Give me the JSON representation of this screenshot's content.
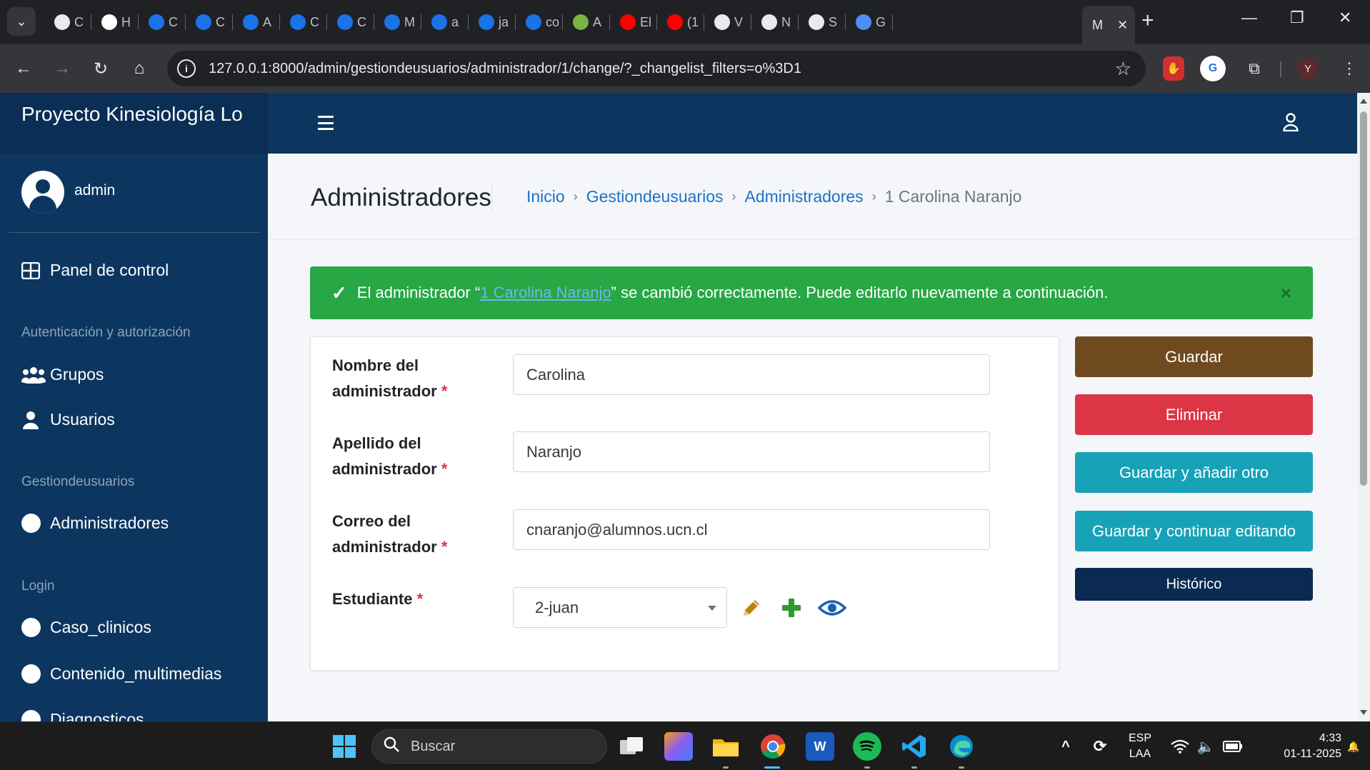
{
  "browser": {
    "tabs": [
      {
        "label": "C",
        "icon": "shield-icon",
        "color": "#e8eaed"
      },
      {
        "label": "H",
        "icon": "github-icon",
        "color": "#ffffff"
      },
      {
        "label": "C",
        "icon": "gear-badge-icon",
        "color": "#1a73e8"
      },
      {
        "label": "C",
        "icon": "gear-badge-icon",
        "color": "#1a73e8"
      },
      {
        "label": "A",
        "icon": "gear-badge-icon",
        "color": "#1a73e8"
      },
      {
        "label": "C",
        "icon": "gear-badge-icon",
        "color": "#1a73e8"
      },
      {
        "label": "C",
        "icon": "gear-badge-icon",
        "color": "#1a73e8"
      },
      {
        "label": "M",
        "icon": "gear-badge-icon",
        "color": "#1a73e8"
      },
      {
        "label": "a",
        "icon": "gear-badge-icon",
        "color": "#1a73e8"
      },
      {
        "label": "ja",
        "icon": "gear-badge-icon",
        "color": "#1a73e8"
      },
      {
        "label": "co",
        "icon": "gear-badge-icon",
        "color": "#1a73e8"
      },
      {
        "label": "A",
        "icon": "id-icon",
        "color": "#7cb342"
      },
      {
        "label": "El",
        "icon": "youtube-icon",
        "color": "#ff0000"
      },
      {
        "label": "(1",
        "icon": "youtube-icon",
        "color": "#ff0000"
      },
      {
        "label": "V",
        "icon": "openai-icon",
        "color": "#e8eaed"
      },
      {
        "label": "N",
        "icon": "openai-icon",
        "color": "#e8eaed"
      },
      {
        "label": "S",
        "icon": "openai-icon",
        "color": "#e8eaed"
      },
      {
        "label": "G",
        "icon": "gemini-icon",
        "color": "#4f8ef7"
      }
    ],
    "active_tab": {
      "label": "M",
      "close": "✕"
    },
    "url": "127.0.0.1:8000/admin/gestiondeusuarios/administrador/1/change/?_changelist_filters=o%3D1",
    "profile_initial": "Y"
  },
  "sidebar": {
    "brand": "Proyecto Kinesiología Lo",
    "user": "admin",
    "items": [
      {
        "label": "Panel de control",
        "icon": "dashboard-icon"
      },
      {
        "label": "Grupos",
        "icon": "users-icon"
      },
      {
        "label": "Usuarios",
        "icon": "user-icon"
      },
      {
        "label": "Administradores",
        "icon": "circle-icon"
      },
      {
        "label": "Caso_clinicos",
        "icon": "circle-icon"
      },
      {
        "label": "Contenido_multimedias",
        "icon": "circle-icon"
      },
      {
        "label": "Diagnosticos",
        "icon": "circle-icon"
      }
    ],
    "headers": [
      "Autenticación y autorización",
      "Gestiondeusuarios",
      "Login"
    ]
  },
  "header": {
    "title": "Administradores",
    "breadcrumb": [
      "Inicio",
      "Gestiondeusuarios",
      "Administradores"
    ],
    "breadcrumb_current": "1 Carolina Naranjo",
    "breadcrumb_sep": "›"
  },
  "alert": {
    "prefix": "El administrador “",
    "link": "1 Carolina Naranjo",
    "suffix": "” se cambió correctamente. Puede editarlo nuevamente a continuación.",
    "close": "×",
    "color": "#28a745"
  },
  "form": {
    "fields": [
      {
        "label_line1": "Nombre del",
        "label_line2": "administrador",
        "value": "Carolina"
      },
      {
        "label_line1": "Apellido del",
        "label_line2": "administrador",
        "value": "Naranjo"
      },
      {
        "label_line1": "Correo del",
        "label_line2": "administrador",
        "value": "cnaranjo@alumnos.ucn.cl"
      }
    ],
    "estudiante_label": "Estudiante",
    "estudiante_value": "2-juan",
    "required_mark": "*"
  },
  "actions": {
    "guardar": {
      "label": "Guardar",
      "color": "#6f4a1f"
    },
    "eliminar": {
      "label": "Eliminar",
      "color": "#dc3545"
    },
    "guardar_anadir": {
      "label": "Guardar y añadir otro",
      "color": "#17a2b8"
    },
    "guardar_continuar": {
      "label": "Guardar y continuar editando",
      "color": "#17a2b8"
    },
    "historico": {
      "label": "Histórico",
      "color": "#0b2a52"
    }
  },
  "taskbar": {
    "search_placeholder": "Buscar",
    "lang_line1": "ESP",
    "lang_line2": "LAA",
    "time": "4:33",
    "date": "01-11-2025"
  }
}
